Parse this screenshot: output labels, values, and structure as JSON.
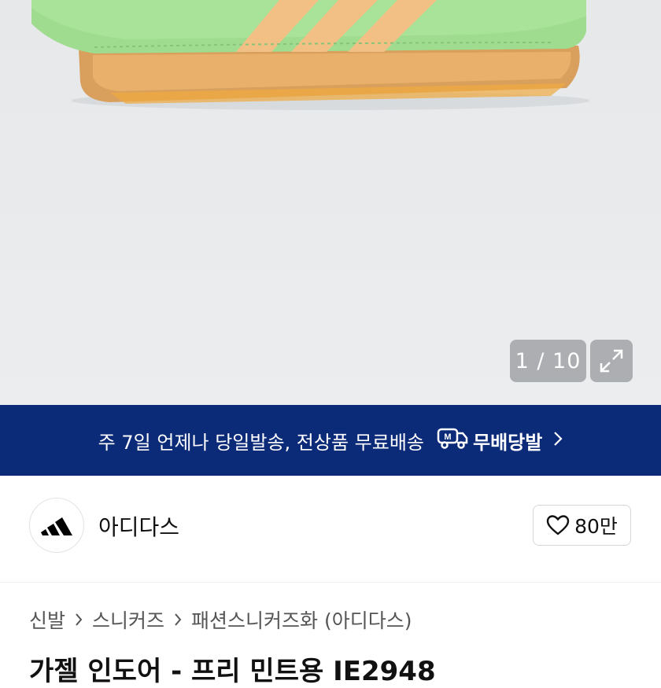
{
  "gallery": {
    "counter_text": "1 / 10",
    "colors": {
      "upper": "#9fdc8f",
      "stripes": "#f2bf84",
      "sole": "#d9a05d"
    }
  },
  "promo": {
    "message": "주 7일 언제나 당일발송, 전상품 무료배송",
    "brand_label": "무배당발",
    "background": "#0b2a78"
  },
  "brand": {
    "name": "아디다스",
    "like_count": "80만",
    "logo_icon": "adidas-logo-icon"
  },
  "breadcrumb": [
    "신발",
    "스니커즈",
    "패션스니커즈화 (아디다스)"
  ],
  "product": {
    "title_partial": "가젤 인도어 - 프리 민트용 IE2948"
  }
}
